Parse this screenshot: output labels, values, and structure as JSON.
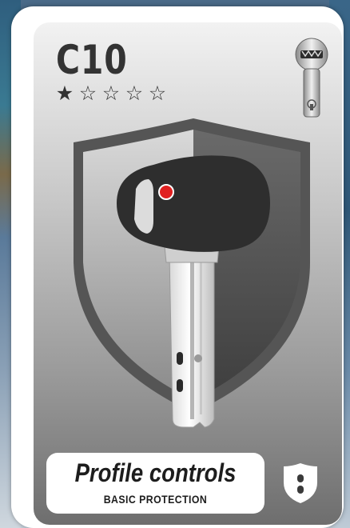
{
  "card": {
    "code": "C10",
    "rating": {
      "value": 1,
      "max": 5
    },
    "label": {
      "title": "Profile controls",
      "subtitle": "BASIC PROTECTION"
    },
    "icons": {
      "cylinder": "lock-cylinder-icon",
      "key": "key-icon",
      "shield_background": "shield-icon",
      "badge": "shield-badge-icon"
    },
    "colors": {
      "key_head": "#2e2e2e",
      "indicator_dot": "#e02020",
      "text": "#333333",
      "label_bg": "#ffffff"
    }
  }
}
